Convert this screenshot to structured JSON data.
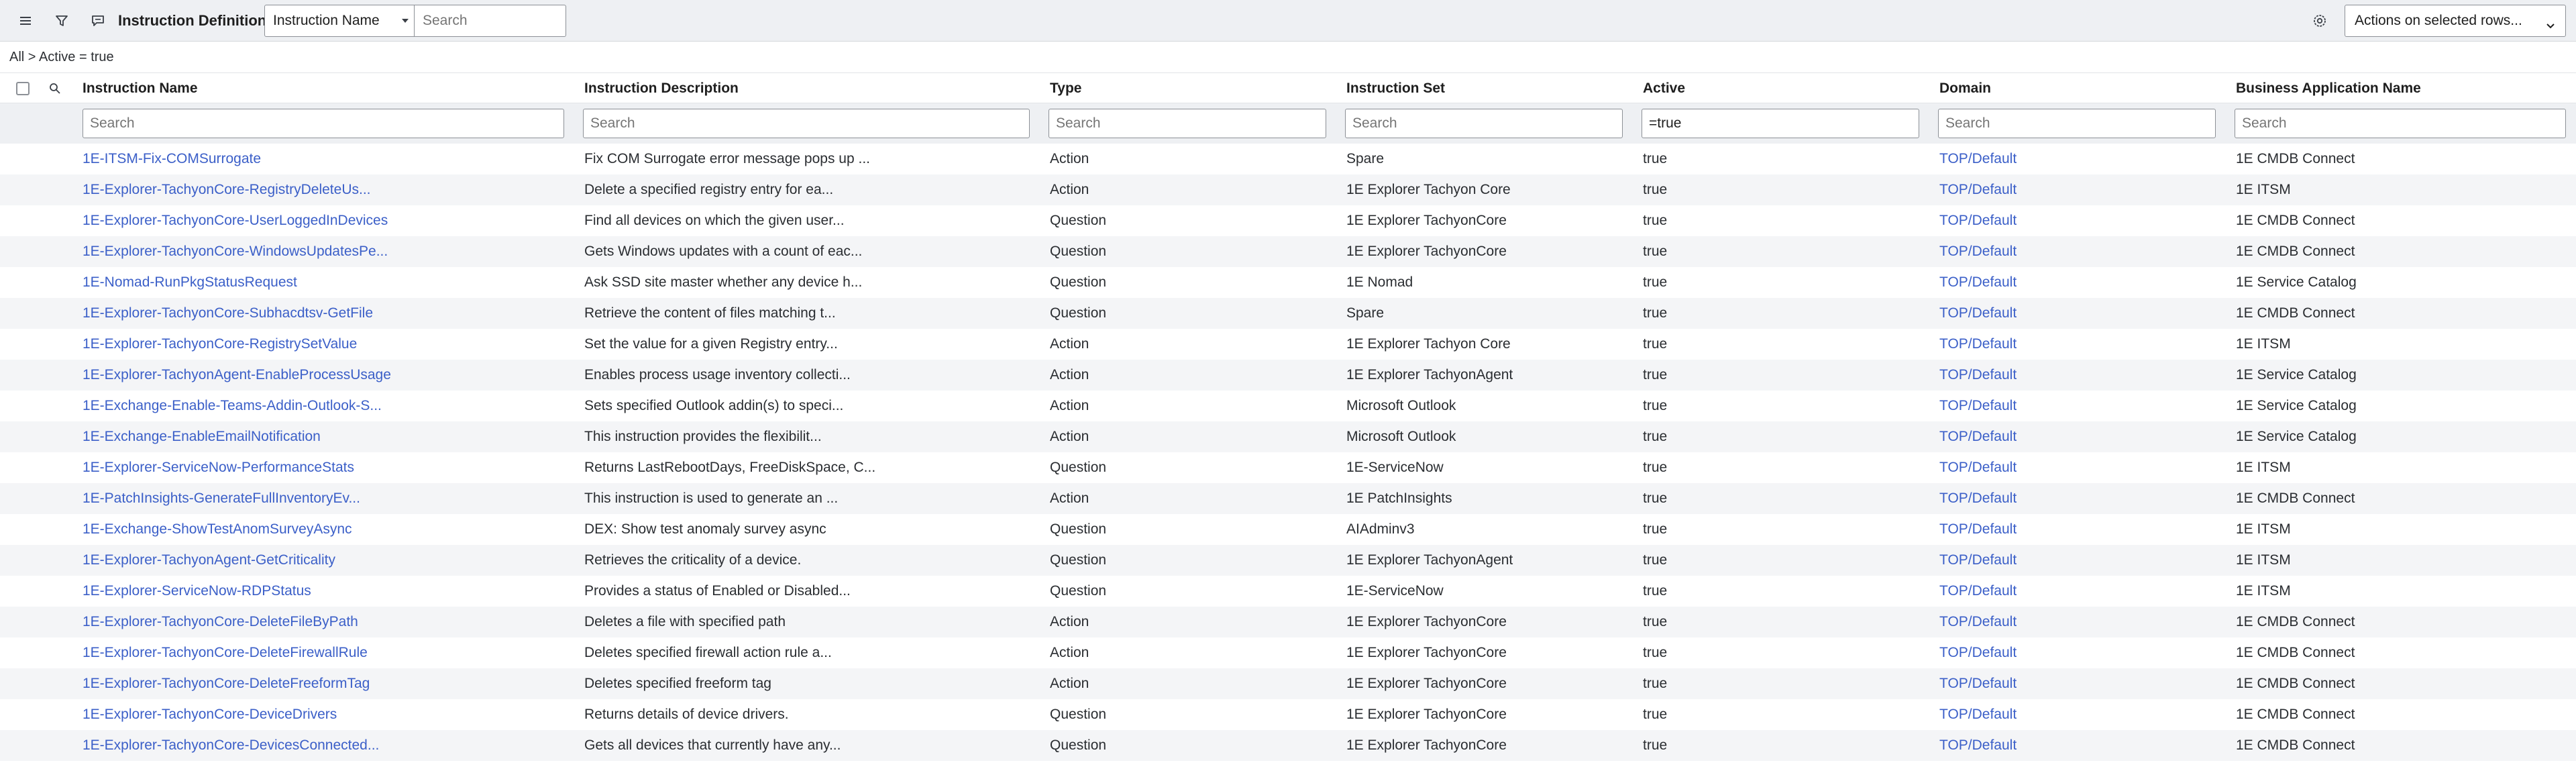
{
  "header": {
    "title": "Instruction Definitions",
    "field_select": "Instruction Name",
    "search_placeholder": "Search",
    "actions_select": "Actions on selected rows..."
  },
  "breadcrumb": {
    "all": "All",
    "separator": ">",
    "filter": "Active = true"
  },
  "columns": [
    {
      "label": "Instruction Name",
      "filter_value": "",
      "filter_placeholder": "Search"
    },
    {
      "label": "Instruction Description",
      "filter_value": "",
      "filter_placeholder": "Search"
    },
    {
      "label": "Type",
      "filter_value": "",
      "filter_placeholder": "Search"
    },
    {
      "label": "Instruction Set",
      "filter_value": "",
      "filter_placeholder": "Search"
    },
    {
      "label": "Active",
      "filter_value": "=true",
      "filter_placeholder": "Search"
    },
    {
      "label": "Domain",
      "filter_value": "",
      "filter_placeholder": "Search"
    },
    {
      "label": "Business Application Name",
      "filter_value": "",
      "filter_placeholder": "Search"
    }
  ],
  "rows": [
    {
      "name": "1E-ITSM-Fix-COMSurrogate",
      "description": "Fix COM Surrogate error message pops up ...",
      "type": "Action",
      "set": "Spare",
      "active": "true",
      "domain": "TOP/Default",
      "app": "1E CMDB Connect"
    },
    {
      "name": "1E-Explorer-TachyonCore-RegistryDeleteUs...",
      "description": "Delete a specified registry entry for ea...",
      "type": "Action",
      "set": "1E Explorer Tachyon Core",
      "active": "true",
      "domain": "TOP/Default",
      "app": "1E ITSM"
    },
    {
      "name": "1E-Explorer-TachyonCore-UserLoggedInDevices",
      "description": "Find all devices on which the given user...",
      "type": "Question",
      "set": "1E Explorer TachyonCore",
      "active": "true",
      "domain": "TOP/Default",
      "app": "1E CMDB Connect"
    },
    {
      "name": "1E-Explorer-TachyonCore-WindowsUpdatesPe...",
      "description": "Gets Windows updates with a count of eac...",
      "type": "Question",
      "set": "1E Explorer TachyonCore",
      "active": "true",
      "domain": "TOP/Default",
      "app": "1E CMDB Connect"
    },
    {
      "name": "1E-Nomad-RunPkgStatusRequest",
      "description": "Ask SSD site master whether any device h...",
      "type": "Question",
      "set": "1E Nomad",
      "active": "true",
      "domain": "TOP/Default",
      "app": "1E Service Catalog"
    },
    {
      "name": "1E-Explorer-TachyonCore-Subhacdtsv-GetFile",
      "description": "Retrieve the content of files matching t...",
      "type": "Question",
      "set": "Spare",
      "active": "true",
      "domain": "TOP/Default",
      "app": "1E CMDB Connect"
    },
    {
      "name": "1E-Explorer-TachyonCore-RegistrySetValue",
      "description": "Set the value for a given Registry entry...",
      "type": "Action",
      "set": "1E Explorer Tachyon Core",
      "active": "true",
      "domain": "TOP/Default",
      "app": "1E ITSM"
    },
    {
      "name": "1E-Explorer-TachyonAgent-EnableProcessUsage",
      "description": "Enables process usage inventory collecti...",
      "type": "Action",
      "set": "1E Explorer TachyonAgent",
      "active": "true",
      "domain": "TOP/Default",
      "app": "1E Service Catalog"
    },
    {
      "name": "1E-Exchange-Enable-Teams-Addin-Outlook-S...",
      "description": "Sets specified Outlook addin(s) to speci...",
      "type": "Action",
      "set": "Microsoft Outlook",
      "active": "true",
      "domain": "TOP/Default",
      "app": "1E Service Catalog"
    },
    {
      "name": "1E-Exchange-EnableEmailNotification",
      "description": "This instruction provides the flexibilit...",
      "type": "Action",
      "set": "Microsoft Outlook",
      "active": "true",
      "domain": "TOP/Default",
      "app": "1E Service Catalog"
    },
    {
      "name": "1E-Explorer-ServiceNow-PerformanceStats",
      "description": "Returns LastRebootDays, FreeDiskSpace, C...",
      "type": "Question",
      "set": "1E-ServiceNow",
      "active": "true",
      "domain": "TOP/Default",
      "app": "1E ITSM"
    },
    {
      "name": "1E-PatchInsights-GenerateFullInventoryEv...",
      "description": "This instruction is used to generate an ...",
      "type": "Action",
      "set": "1E PatchInsights",
      "active": "true",
      "domain": "TOP/Default",
      "app": "1E CMDB Connect"
    },
    {
      "name": "1E-Exchange-ShowTestAnomSurveyAsync",
      "description": "DEX: Show test anomaly survey async",
      "type": "Question",
      "set": "AIAdminv3",
      "active": "true",
      "domain": "TOP/Default",
      "app": "1E ITSM"
    },
    {
      "name": "1E-Explorer-TachyonAgent-GetCriticality",
      "description": "Retrieves the criticality of a device.",
      "type": "Question",
      "set": "1E Explorer TachyonAgent",
      "active": "true",
      "domain": "TOP/Default",
      "app": "1E ITSM"
    },
    {
      "name": "1E-Explorer-ServiceNow-RDPStatus",
      "description": "Provides a status of Enabled or Disabled...",
      "type": "Question",
      "set": "1E-ServiceNow",
      "active": "true",
      "domain": "TOP/Default",
      "app": "1E ITSM"
    },
    {
      "name": "1E-Explorer-TachyonCore-DeleteFileByPath",
      "description": "Deletes a file with specified path",
      "type": "Action",
      "set": "1E Explorer TachyonCore",
      "active": "true",
      "domain": "TOP/Default",
      "app": "1E CMDB Connect"
    },
    {
      "name": "1E-Explorer-TachyonCore-DeleteFirewallRule",
      "description": "Deletes specified firewall action rule a...",
      "type": "Action",
      "set": "1E Explorer TachyonCore",
      "active": "true",
      "domain": "TOP/Default",
      "app": "1E CMDB Connect"
    },
    {
      "name": "1E-Explorer-TachyonCore-DeleteFreeformTag",
      "description": "Deletes specified freeform tag",
      "type": "Action",
      "set": "1E Explorer TachyonCore",
      "active": "true",
      "domain": "TOP/Default",
      "app": "1E CMDB Connect"
    },
    {
      "name": "1E-Explorer-TachyonCore-DeviceDrivers",
      "description": "Returns details of device drivers.",
      "type": "Question",
      "set": "1E Explorer TachyonCore",
      "active": "true",
      "domain": "TOP/Default",
      "app": "1E CMDB Connect"
    },
    {
      "name": "1E-Explorer-TachyonCore-DevicesConnected...",
      "description": "Gets all devices that currently have any...",
      "type": "Question",
      "set": "1E Explorer TachyonCore",
      "active": "true",
      "domain": "TOP/Default",
      "app": "1E CMDB Connect"
    }
  ],
  "icons": {
    "menu": "hamburger-menu-icon",
    "filter": "funnel-filter-icon",
    "comment": "speech-bubble-icon",
    "settings": "gear-icon",
    "search": "magnifier-icon"
  },
  "colors": {
    "link": "#3b5fc8",
    "header_bg": "#eef0f3",
    "row_alt": "#f4f5f7"
  }
}
